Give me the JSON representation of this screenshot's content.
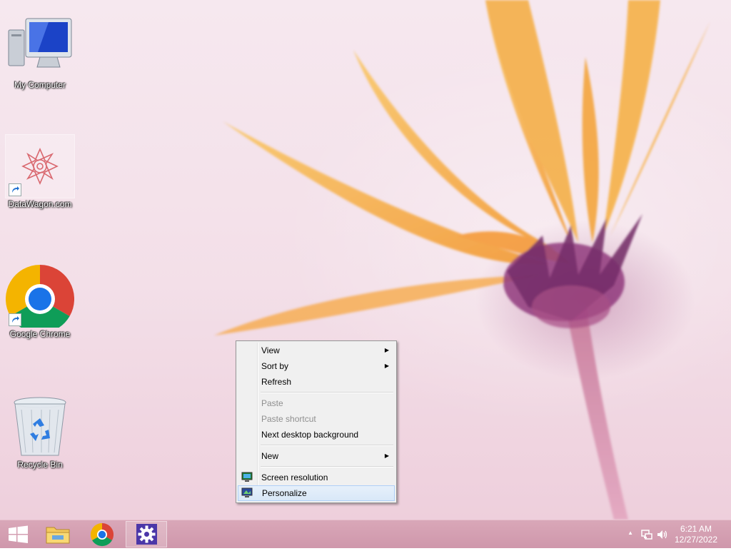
{
  "desktop_icons": [
    {
      "label": "My Computer",
      "icon": "my-computer-icon"
    },
    {
      "label": "DataWagon.com",
      "icon": "datawagon-logo-icon",
      "shortcut": true
    },
    {
      "label": "Google Chrome",
      "icon": "chrome-icon",
      "shortcut": true
    },
    {
      "label": "Recycle Bin",
      "icon": "recycle-bin-icon"
    }
  ],
  "context_menu": {
    "items": [
      {
        "label": "View",
        "submenu": true,
        "enabled": true
      },
      {
        "label": "Sort by",
        "submenu": true,
        "enabled": true
      },
      {
        "label": "Refresh",
        "submenu": false,
        "enabled": true
      },
      {
        "label": "Paste",
        "submenu": false,
        "enabled": false
      },
      {
        "label": "Paste shortcut",
        "submenu": false,
        "enabled": false
      },
      {
        "label": "Next desktop background",
        "submenu": false,
        "enabled": true
      },
      {
        "label": "New",
        "submenu": true,
        "enabled": true
      },
      {
        "label": "Screen resolution",
        "submenu": false,
        "enabled": true,
        "icon": "screen-resolution-icon"
      },
      {
        "label": "Personalize",
        "submenu": false,
        "enabled": true,
        "icon": "personalize-icon",
        "highlighted": true
      }
    ],
    "submenu_arrow": "▶"
  },
  "taskbar": {
    "buttons": [
      {
        "icon": "windows-start-icon"
      },
      {
        "icon": "file-explorer-icon"
      },
      {
        "icon": "chrome-icon"
      },
      {
        "icon": "settings-gear-icon",
        "active": true
      }
    ],
    "tray": {
      "show_hidden_arrow": "▲",
      "network_icon": "network-icon",
      "volume_icon": "volume-icon"
    },
    "clock": {
      "time": "6:21 AM",
      "date": "12/27/2022"
    }
  },
  "colors": {
    "taskbar": "#d3a0b2",
    "menu_highlight": "#d9e8f8",
    "flower_petal": "#f6b24a",
    "flower_center": "#7a2a6a"
  }
}
